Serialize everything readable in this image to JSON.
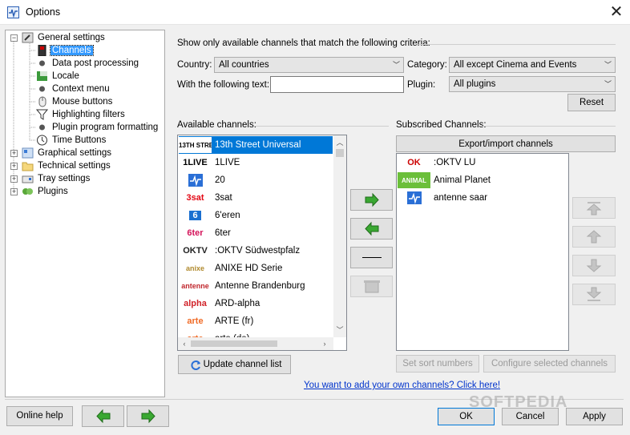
{
  "window": {
    "title": "Options",
    "close_glyph": "✕"
  },
  "tree": {
    "items": [
      {
        "label": "General settings",
        "icon": "wrench-icon"
      },
      {
        "label": "Channels",
        "icon": "channels-icon",
        "selected": true
      },
      {
        "label": "Data post processing",
        "icon": "gear-icon"
      },
      {
        "label": "Locale",
        "icon": "locale-icon"
      },
      {
        "label": "Context menu",
        "icon": "gear-icon"
      },
      {
        "label": "Mouse buttons",
        "icon": "mouse-icon"
      },
      {
        "label": "Highlighting filters",
        "icon": "filter-icon"
      },
      {
        "label": "Plugin program formatting",
        "icon": "gear-icon"
      },
      {
        "label": "Time Buttons",
        "icon": "clock-icon"
      },
      {
        "label": "Graphical settings",
        "icon": "palette-icon"
      },
      {
        "label": "Technical settings",
        "icon": "folder-icon"
      },
      {
        "label": "Tray settings",
        "icon": "tray-icon"
      },
      {
        "label": "Plugins",
        "icon": "plugins-icon"
      }
    ]
  },
  "filter": {
    "heading": "Show only available channels that match the following criteria:",
    "country_label": "Country:",
    "country_value": "All countries",
    "category_label": "Category:",
    "category_value": "All except Cinema and Events",
    "text_label": "With the following text:",
    "text_value": "",
    "plugin_label": "Plugin:",
    "plugin_value": "All plugins",
    "reset_label": "Reset"
  },
  "available": {
    "heading": "Available channels:",
    "channels": [
      {
        "name": "13th Street Universal",
        "logo": "13TH STREET",
        "logo_color": "#000000",
        "selected": true
      },
      {
        "name": "1LIVE",
        "logo": "1LIVE",
        "logo_color": "#cc0000"
      },
      {
        "name": "20",
        "logo": "~",
        "logo_color": "#2a6fd6"
      },
      {
        "name": "3sat",
        "logo": "3sat",
        "logo_color": "#e30613"
      },
      {
        "name": "6'eren",
        "logo": "6",
        "logo_color": "#1a6fd0"
      },
      {
        "name": "6ter",
        "logo": "6ter",
        "logo_color": "#d4145a"
      },
      {
        "name": ":OKTV Südwestpfalz",
        "logo": "OKTV",
        "logo_color": "#222222"
      },
      {
        "name": "ANIXE HD Serie",
        "logo": "anixe",
        "logo_color": "#b08a2e"
      },
      {
        "name": "Antenne Brandenburg",
        "logo": "antenne",
        "logo_color": "#c0272d"
      },
      {
        "name": "ARD-alpha",
        "logo": "alpha",
        "logo_color": "#d1232a"
      },
      {
        "name": "ARTE (fr)",
        "logo": "arte",
        "logo_color": "#f06a25"
      },
      {
        "name": "arte (de)",
        "logo": "arte",
        "logo_color": "#f06a25"
      }
    ]
  },
  "subscribed": {
    "heading": "Subscribed Channels:",
    "export_label": "Export/import channels",
    "channels": [
      {
        "name": ":OKTV LU",
        "logo": "OK",
        "logo_color": "#cc0000"
      },
      {
        "name": "Animal Planet",
        "logo": "ANIMAL",
        "logo_color": "#2e8b2e"
      },
      {
        "name": "antenne saar",
        "logo": "~",
        "logo_color": "#2a6fd6"
      }
    ]
  },
  "actions": {
    "update_label": "Update channel list",
    "sort_label": "Set sort numbers",
    "configure_label": "Configure selected channels",
    "own_channels_link": "You want to add your own channels? Click here!"
  },
  "footer": {
    "help_label": "Online help",
    "ok_label": "OK",
    "cancel_label": "Cancel",
    "apply_label": "Apply"
  },
  "watermark": "SOFTPEDIA",
  "colors": {
    "accent": "#0078d7",
    "arrow_green": "#3aa832",
    "link": "#0033cc"
  }
}
